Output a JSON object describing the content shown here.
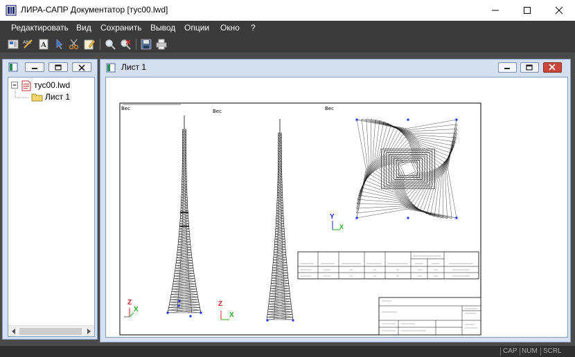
{
  "window": {
    "title": "ЛИРА-САПР Документатор [тус00.lwd]"
  },
  "menu": {
    "items": [
      {
        "label": "Редактировать"
      },
      {
        "label": "Вид"
      },
      {
        "label": "Сохранить"
      },
      {
        "label": "Вывод"
      },
      {
        "label": "Опции"
      },
      {
        "label": "Окно"
      },
      {
        "label": "?"
      }
    ]
  },
  "toolbar": {
    "buttons": [
      {
        "icon": "layout-icon"
      },
      {
        "icon": "spell-check-icon"
      },
      {
        "icon": "text-format-icon"
      },
      {
        "icon": "pointer-icon"
      },
      {
        "icon": "cut-icon"
      },
      {
        "icon": "edit-icon"
      },
      {
        "icon": "zoom-in-icon"
      },
      {
        "icon": "zoom-out-icon"
      },
      {
        "icon": "save-icon"
      },
      {
        "icon": "print-icon"
      }
    ]
  },
  "tree": {
    "root_label": "тус00.lwd",
    "child_label": "Лист 1"
  },
  "document": {
    "title": "Лист 1",
    "sheet": {
      "view_label_1": "Вес",
      "view_label_2": "Вес",
      "view_label_3": "Вес",
      "axes": {
        "z": "Z",
        "x": "X",
        "y": "Y"
      }
    }
  },
  "status": {
    "cap": "CAP",
    "num": "NUM",
    "scrl": "SCRL"
  },
  "colors": {
    "menu_bg": "#3b3b3b",
    "panel_bg": "#d4dff0",
    "close_red": "#c9463b",
    "folder_yellow": "#f3d66b",
    "node_blue": "#1a2fd6"
  }
}
